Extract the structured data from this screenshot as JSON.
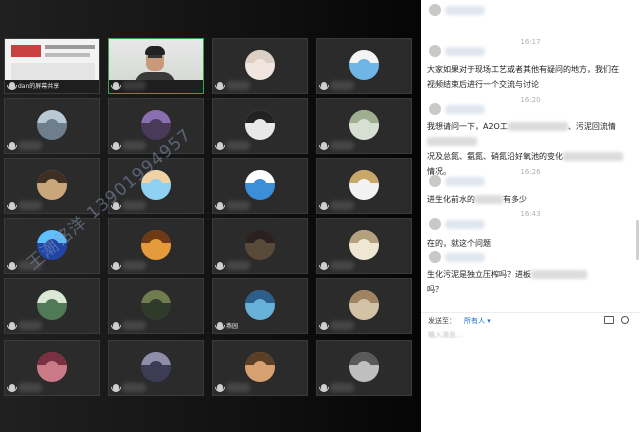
{
  "grid": {
    "watermark": "王潮铭洋 13901994957",
    "tiles": [
      {
        "kind": "screen",
        "name": "dan的屏幕共享",
        "badge": "2022"
      },
      {
        "kind": "camera"
      },
      {
        "kind": "avatar",
        "c": "#f0e6df",
        "h": "#dcd0c6"
      },
      {
        "kind": "avatar",
        "c": "#6fb6e6",
        "h": "#f4f4f4"
      },
      {
        "kind": "avatar",
        "c": "#6e7e8c",
        "h": "#b9c9d3"
      },
      {
        "kind": "avatar",
        "c": "#4a3a5a",
        "h": "#8a6fb0"
      },
      {
        "kind": "avatar",
        "c": "#e8e8e8",
        "h": "#222222"
      },
      {
        "kind": "avatar",
        "c": "#d7dfd3",
        "h": "#9fae8e"
      },
      {
        "kind": "avatar",
        "c": "#c9a77a",
        "h": "#3e2f22"
      },
      {
        "kind": "avatar",
        "c": "#8fd1f0",
        "h": "#f1d2a4"
      },
      {
        "kind": "avatar",
        "c": "#3d8ed8",
        "h": "#ffffff"
      },
      {
        "kind": "avatar",
        "c": "#f2f2f2",
        "h": "#c9a66a"
      },
      {
        "kind": "avatar",
        "c": "#2145a6",
        "h": "#5ec0ff"
      },
      {
        "kind": "avatar",
        "c": "#e59a3c",
        "h": "#6e3a16"
      },
      {
        "kind": "avatar",
        "c": "#5a4a3a",
        "h": "#2a2020"
      },
      {
        "kind": "avatar",
        "c": "#efe7d2",
        "h": "#b4a07c"
      },
      {
        "kind": "avatar",
        "c": "#4f7a55",
        "h": "#dbe8d6"
      },
      {
        "kind": "avatar",
        "c": "#2f3a2a",
        "h": "#6f7c4f"
      },
      {
        "kind": "avatar",
        "c": "#67b0d8",
        "h": "#2b5e8a",
        "name": "燕园"
      },
      {
        "kind": "avatar",
        "c": "#d3c2a6",
        "h": "#a08462"
      },
      {
        "kind": "avatar",
        "c": "#c97a86",
        "h": "#7a3040"
      },
      {
        "kind": "avatar",
        "c": "#3c3c54",
        "h": "#8e8ea8"
      },
      {
        "kind": "avatar",
        "c": "#d6a070",
        "h": "#5a3f26"
      },
      {
        "kind": "avatar",
        "c": "#bfbfbf",
        "h": "#5a5a5a"
      }
    ]
  },
  "chat": {
    "messages": [
      {
        "time": "16:17",
        "text": [
          "大家如果对于现场工艺或者其他有疑问的地方，我们在",
          "视频结束后进行一个交流与讨论"
        ]
      },
      {
        "time": "16:20",
        "text": [
          "我想请问一下，A2O工",
          "、污泥回流情",
          "况及总氮、氨氮、硝氮沿",
          "好氧池的变化",
          "情况。"
        ]
      },
      {
        "time": "16:26",
        "text": [
          "进生化前水的",
          "有多少"
        ]
      },
      {
        "time": "16:43",
        "text": [
          "在的，就这个问题"
        ]
      },
      {
        "time": "",
        "text": [
          "生化污泥是独立压榨吗？进板",
          "吗？"
        ]
      }
    ],
    "footer": {
      "send_to_label": "发送至：",
      "send_to_value": "所有人 ▾",
      "placeholder": "输入消息..."
    }
  }
}
